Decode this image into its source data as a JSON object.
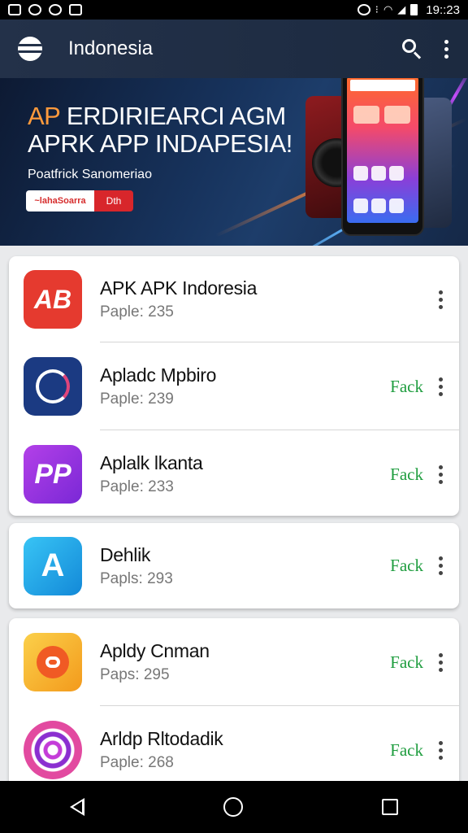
{
  "status_bar": {
    "time": "19::23"
  },
  "app_bar": {
    "title": "Indonesia"
  },
  "banner": {
    "headline_prefix": "AP",
    "headline_line1_rest": " ERDIRIEARCI AGM",
    "headline_line2": "APRK APP INDAPESIA!",
    "subtitle": "Poatfrick Sanomeriao",
    "cta_left": "~lahaSoarra",
    "cta_right": "Dth"
  },
  "apps": [
    {
      "name": "APK APK Indoresia",
      "meta": "Paple: 235",
      "action": "",
      "icon": "ab-logo-icon",
      "color": "#e53a2f"
    },
    {
      "name": "Apladc Mpbiro",
      "meta": "Paple: 239",
      "action": "Fack",
      "icon": "a-swoosh-icon",
      "color": "#1b3a82"
    },
    {
      "name": "Aplalk lkanta",
      "meta": "Paple: 233",
      "action": "Fack",
      "icon": "pp-logo-icon",
      "color": "#8b2fe0"
    },
    {
      "name": "Dehlik",
      "meta": "Papls: 293",
      "action": "Fack",
      "icon": "a-arrow-icon",
      "color": "#1aa7e8"
    },
    {
      "name": "Apldy Cnman",
      "meta": "Paps: 295",
      "action": "Fack",
      "icon": "chat-ring-icon",
      "color": "#f6b21b"
    },
    {
      "name": "Arldp Rltodadik",
      "meta": "Paple: 268",
      "action": "Fack",
      "icon": "spiral-icon",
      "color": "#9b2fd0"
    }
  ]
}
